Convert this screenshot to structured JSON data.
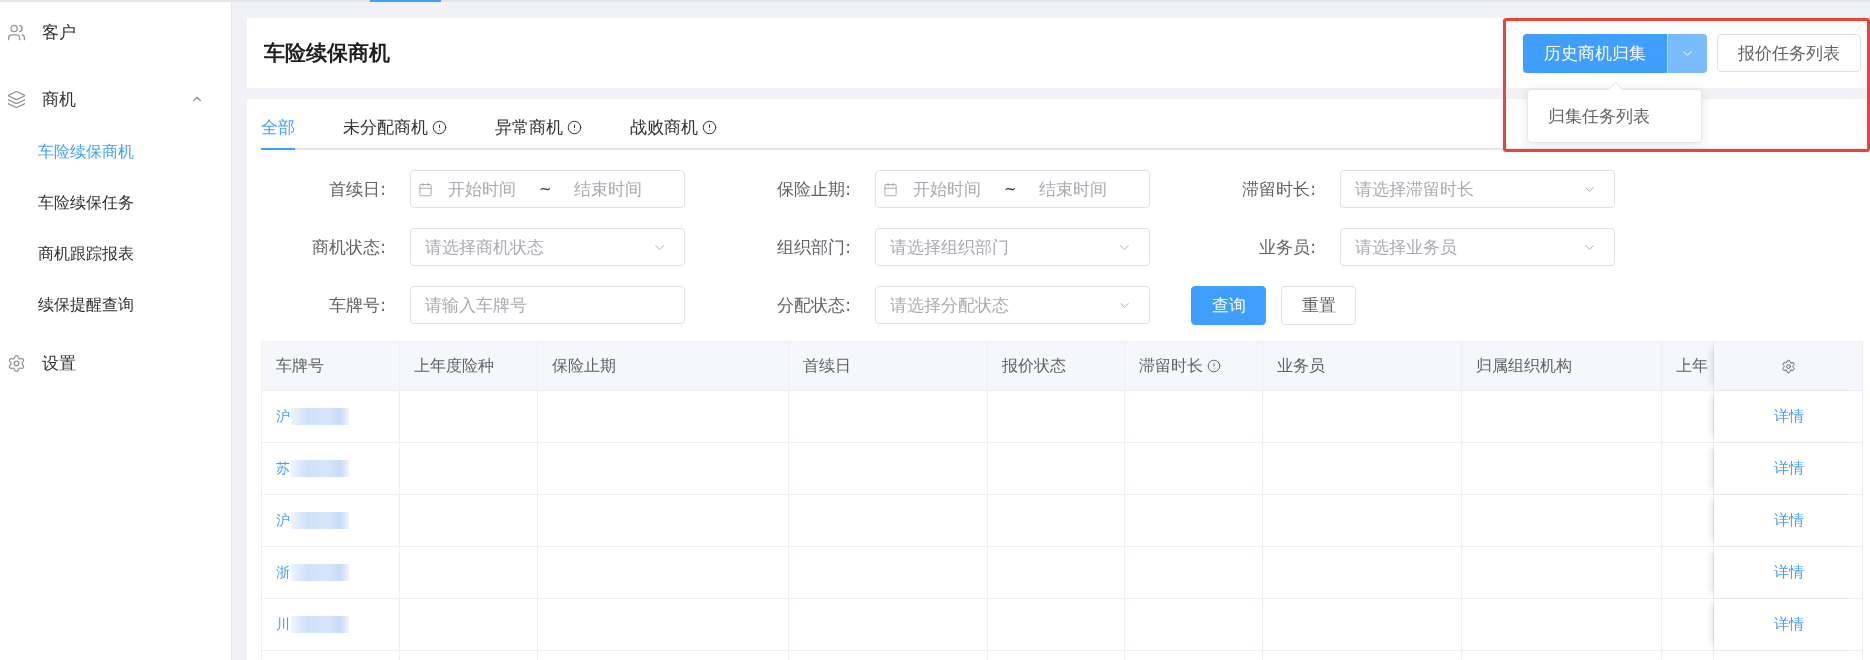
{
  "top_tab_strip": {
    "active_indicator": true
  },
  "sidebar": {
    "items": [
      {
        "label": "客户",
        "kind": "item"
      },
      {
        "label": "商机",
        "kind": "group",
        "expanded": true,
        "children": [
          {
            "label": "车险续保商机",
            "selected": true
          },
          {
            "label": "车险续保任务",
            "selected": false
          },
          {
            "label": "商机跟踪报表",
            "selected": false
          },
          {
            "label": "续保提醒查询",
            "selected": false
          }
        ]
      },
      {
        "label": "设置",
        "kind": "item"
      }
    ]
  },
  "page_header": {
    "title": "车险续保商机",
    "actions": {
      "highlighted": true,
      "split_button": {
        "label": "历史商机归集",
        "expanded": true,
        "menu": [
          "归集任务列表"
        ]
      },
      "button": "报价任务列表"
    }
  },
  "tabs": [
    {
      "label": "全部",
      "selected": true
    },
    {
      "label": "未分配商机",
      "selected": false,
      "info_icon": true
    },
    {
      "label": "异常商机",
      "selected": false,
      "info_icon": true
    },
    {
      "label": "战败商机",
      "selected": false,
      "info_icon": true
    }
  ],
  "filters": [
    {
      "label": "首续日:",
      "kind": "date_range",
      "start_placeholder": "开始时间",
      "separator": "~",
      "end_placeholder": "结束时间"
    },
    {
      "label": "保险止期:",
      "kind": "date_range",
      "start_placeholder": "开始时间",
      "separator": "~",
      "end_placeholder": "结束时间"
    },
    {
      "label": "滞留时长:",
      "kind": "select",
      "placeholder": "请选择滞留时长"
    },
    {
      "label": "商机状态:",
      "kind": "select",
      "placeholder": "请选择商机状态"
    },
    {
      "label": "组织部门:",
      "kind": "select",
      "placeholder": "请选择组织部门"
    },
    {
      "label": "业务员:",
      "kind": "select",
      "placeholder": "请选择业务员"
    },
    {
      "label": "车牌号:",
      "kind": "text",
      "placeholder": "请输入车牌号"
    },
    {
      "label": "分配状态:",
      "kind": "select",
      "placeholder": "请选择分配状态"
    }
  ],
  "filter_buttons": [
    {
      "label": "查询",
      "kind": "primary"
    },
    {
      "label": "重置",
      "kind": "plain"
    }
  ],
  "table": {
    "columns": [
      {
        "label": "车牌号"
      },
      {
        "label": "上年度险种"
      },
      {
        "label": "保险止期"
      },
      {
        "label": "首续日"
      },
      {
        "label": "报价状态"
      },
      {
        "label": "滞留时长",
        "info_icon": true
      },
      {
        "label": "业务员"
      },
      {
        "label": "归属组织机构"
      },
      {
        "label": "上年"
      }
    ],
    "rows": [
      {
        "plate": "沪",
        "masked": true,
        "action": "详情"
      },
      {
        "plate": "苏",
        "masked": true,
        "action": "详情"
      },
      {
        "plate": "沪",
        "masked": true,
        "action": "详情"
      },
      {
        "plate": "浙",
        "masked": true,
        "action": "详情"
      },
      {
        "plate": "川",
        "masked": true,
        "action": "详情"
      }
    ]
  }
}
